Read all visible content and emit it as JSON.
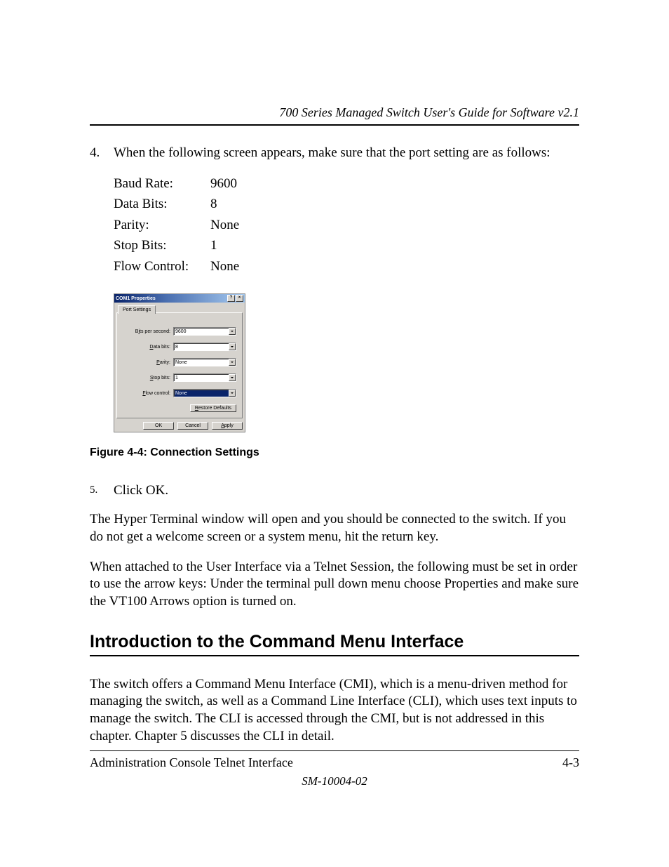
{
  "running_head": "700 Series Managed Switch User's Guide for Software v2.1",
  "step4": {
    "num": "4.",
    "text": "When the following screen appears, make sure that the port setting are as follows:"
  },
  "settings": [
    {
      "k": "Baud Rate:",
      "v": "9600"
    },
    {
      "k": "Data Bits:",
      "v": "8"
    },
    {
      "k": "Parity:",
      "v": "None"
    },
    {
      "k": "Stop Bits:",
      "v": "1"
    },
    {
      "k": "Flow Control:",
      "v": "None"
    }
  ],
  "dialog": {
    "title": "COM1 Properties",
    "tab": "Port Settings",
    "fields": {
      "bits_label_pre": "B",
      "bits_label_u": "i",
      "bits_label_post": "ts per second:",
      "bits_value": "9600",
      "data_label_pre": "",
      "data_label_u": "D",
      "data_label_post": "ata bits:",
      "data_value": "8",
      "parity_label_pre": "",
      "parity_label_u": "P",
      "parity_label_post": "arity:",
      "parity_value": "None",
      "stop_label_pre": "",
      "stop_label_u": "S",
      "stop_label_post": "top bits:",
      "stop_value": "1",
      "flow_label_pre": "",
      "flow_label_u": "F",
      "flow_label_post": "low control:",
      "flow_value": "None"
    },
    "restore_pre": "",
    "restore_u": "R",
    "restore_post": "estore Defaults",
    "ok": "OK",
    "cancel": "Cancel",
    "apply_pre": "",
    "apply_u": "A",
    "apply_post": "pply"
  },
  "fig_caption": "Figure 4-4:  Connection Settings",
  "step5": {
    "num": "5.",
    "text": "Click OK."
  },
  "para1": "The Hyper Terminal window will open and you should be connected to the switch.  If you do not get a welcome screen or a system menu, hit the return key.",
  "para2": "When attached to the User Interface via a Telnet Session, the following must be set in order to use the arrow keys: Under the terminal pull down menu choose Properties and make sure the VT100 Arrows option is turned on.",
  "h2": "Introduction to the Command Menu Interface",
  "para3": "The switch offers a Command Menu Interface (CMI), which is a menu-driven method for managing the switch, as well as a Command Line Interface (CLI), which uses text inputs to manage the switch.  The CLI is accessed through the CMI, but is not addressed in this chapter.  Chapter 5 discusses the CLI in detail.",
  "footer_left": "Administration Console Telnet Interface",
  "footer_right": "4-3",
  "docnum": "SM-10004-02"
}
